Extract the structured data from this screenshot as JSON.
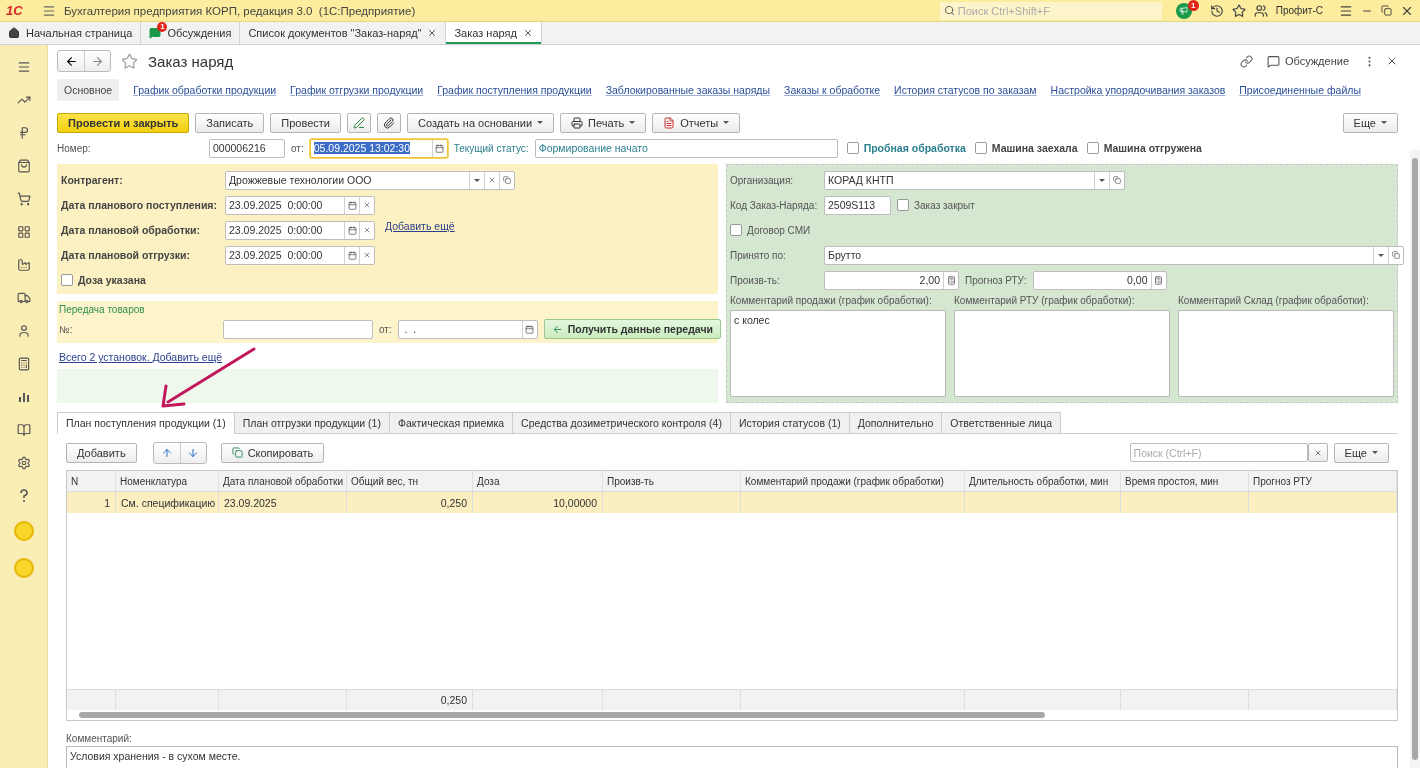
{
  "app": {
    "logo": "1С",
    "title": "Бухгалтерия предприятия КОРП, редакция 3.0  (1С:Предприятие)",
    "search_placeholder": "Поиск Ctrl+Shift+F",
    "notification_count": "1",
    "user": "Профит-С"
  },
  "open_tabs": [
    {
      "label": "Начальная страница",
      "kind": "home",
      "selected": false
    },
    {
      "label": "Обсуждения",
      "kind": "discussions",
      "badge": "1",
      "selected": false
    },
    {
      "label": "Список документов \"Заказ-наряд\"",
      "kind": "closable",
      "selected": false
    },
    {
      "label": "Заказ наряд",
      "kind": "closable",
      "selected": true
    }
  ],
  "form": {
    "title": "Заказ наряд",
    "discussion": "Обсуждение"
  },
  "sections": [
    {
      "label": "Основное",
      "selected": true
    },
    {
      "label": "График обработки продукции",
      "selected": false
    },
    {
      "label": "График отгрузки продукции",
      "selected": false
    },
    {
      "label": "График поступления продукции",
      "selected": false
    },
    {
      "label": "Заблокированные заказы наряды",
      "selected": false
    },
    {
      "label": "Заказы к обработке",
      "selected": false
    },
    {
      "label": "История статусов по заказам",
      "selected": false
    },
    {
      "label": "Настройка упорядочивания заказов",
      "selected": false
    },
    {
      "label": "Присоединенные файлы",
      "selected": false
    }
  ],
  "toolbar": [
    {
      "label": "Провести и закрыть",
      "kind": "primary"
    },
    {
      "label": "Записать",
      "kind": "button"
    },
    {
      "label": "Провести",
      "kind": "button"
    },
    {
      "kind": "pen"
    },
    {
      "kind": "clip"
    },
    {
      "label": "Создать на основании",
      "kind": "dropdown"
    },
    {
      "label": "Печать",
      "kind": "print"
    },
    {
      "label": "Отчеты",
      "kind": "report"
    }
  ],
  "more": "Еще",
  "header": {
    "number_label": "Номер:",
    "number": "000006216",
    "date_label": "от:",
    "date": "05.09.2025 13:02:30",
    "status_label": "Текущий статус:",
    "status": "Формирование начато"
  },
  "flags": [
    {
      "label": "Пробная обработка",
      "kind": "accent",
      "checked": false
    },
    {
      "label": "Машина заехала",
      "kind": "plain",
      "checked": false
    },
    {
      "label": "Машина отгружена",
      "kind": "plain",
      "checked": false
    }
  ],
  "counterparty": {
    "label": "Контрагент:",
    "value": "Дрожжевые технологии ООО"
  },
  "dates": [
    {
      "label": "Дата планового поступления:",
      "value": "23.09.2025  0:00:00"
    },
    {
      "label": "Дата плановой обработки:",
      "value": "23.09.2025  0:00:00",
      "link": "Добавить ещё"
    },
    {
      "label": "Дата плановой отгрузки:",
      "value": "23.09.2025  0:00:00"
    }
  ],
  "dose": {
    "label": "Доза указана",
    "checked": false
  },
  "transfer": {
    "title": "Передача товаров",
    "number_label": "№:",
    "date_label": "от:",
    "date_value": " .  .",
    "button": "Получить данные передачи"
  },
  "summary_link": "Всего 2 установок. Добавить ещё",
  "right": {
    "organization": {
      "label": "Организация:",
      "value": "КОРАД КНТП"
    },
    "code": {
      "label": "Код Заказ-Наряда:",
      "value": "2509S113"
    },
    "closed": {
      "label": "Заказ закрыт",
      "checked": false
    },
    "contract": {
      "label": "Договор СМИ",
      "checked": false
    },
    "accepted": {
      "label": "Принято по:",
      "value": "Брутто"
    },
    "productivity": {
      "label": "Произв-ть:",
      "value": "2,00"
    },
    "forecast": {
      "label": "Прогноз РТУ:",
      "value": "0,00"
    },
    "comments": [
      {
        "label": "Комментарий продажи (график обработки):",
        "value": "с колес"
      },
      {
        "label": "Комментарий РТУ (график обработки):"
      },
      {
        "label": "Комментарий Склад (график обработки):"
      }
    ]
  },
  "detail_tabs": [
    {
      "label": "План поступления продукции (1)",
      "selected": true
    },
    {
      "label": "План отгрузки продукции (1)",
      "selected": false
    },
    {
      "label": "Фактическая приемка",
      "selected": false
    },
    {
      "label": "Средства дозиметрического контроля (4)",
      "selected": false
    },
    {
      "label": "История статусов (1)",
      "selected": false
    },
    {
      "label": "Дополнительно",
      "selected": false
    },
    {
      "label": "Ответственные лица",
      "selected": false
    }
  ],
  "table_toolbar": {
    "add": "Добавить",
    "copy": "Скопировать",
    "search_placeholder": "Поиск (Ctrl+F)",
    "more": "Еще"
  },
  "table": {
    "columns": [
      "N",
      "Номенклатура",
      "Дата плановой обработки",
      "Общий вес, тн",
      "Доза",
      "Произв-ть",
      "Комментарий продажи (график обработки)",
      "Длительность обработки, мин",
      "Время простоя, мин",
      "Прогноз РТУ"
    ],
    "rows": [
      {
        "cells": [
          "1",
          "См. спецификацию",
          "23.09.2025",
          "0,250",
          "10,00000"
        ],
        "selected": true
      }
    ],
    "weight_total": "0,250"
  },
  "comment": {
    "label": "Комментарий:",
    "value": "Условия хранения - в сухом месте."
  }
}
